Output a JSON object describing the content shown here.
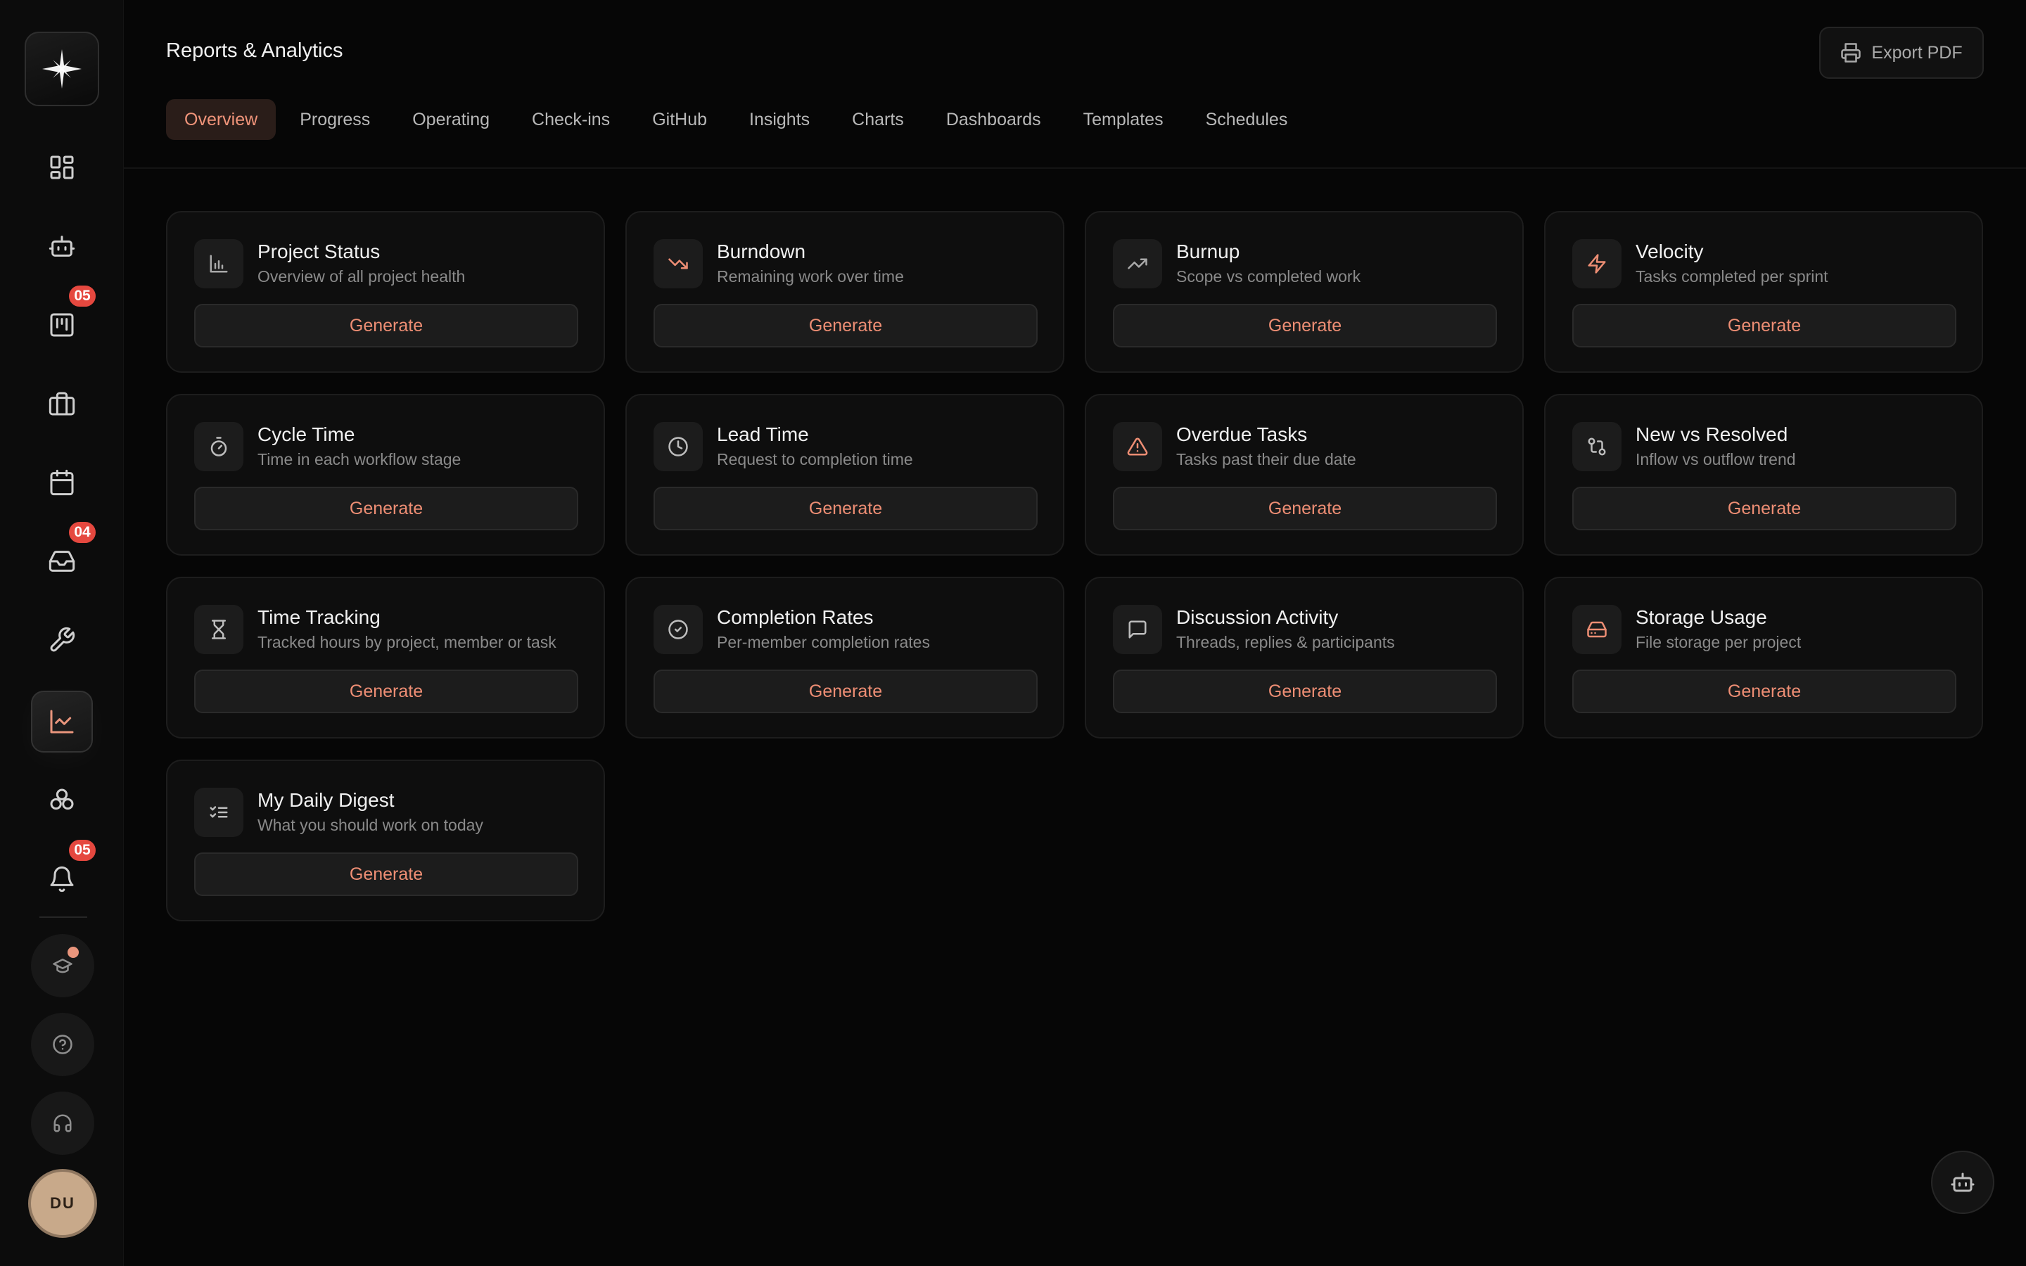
{
  "header": {
    "title": "Reports & Analytics",
    "export_label": "Export PDF"
  },
  "tabs": [
    {
      "label": "Overview",
      "active": true
    },
    {
      "label": "Progress"
    },
    {
      "label": "Operating"
    },
    {
      "label": "Check-ins"
    },
    {
      "label": "GitHub"
    },
    {
      "label": "Insights"
    },
    {
      "label": "Charts"
    },
    {
      "label": "Dashboards"
    },
    {
      "label": "Templates"
    },
    {
      "label": "Schedules"
    }
  ],
  "sidebar": {
    "items": [
      {
        "icon": "dashboard-icon"
      },
      {
        "icon": "robot-icon"
      },
      {
        "icon": "board-icon",
        "badge": "05"
      },
      {
        "icon": "briefcase-icon"
      },
      {
        "icon": "calendar-icon"
      },
      {
        "icon": "inbox-icon",
        "badge": "04"
      },
      {
        "icon": "wrench-icon"
      },
      {
        "icon": "chart-icon",
        "active": true
      },
      {
        "icon": "integrations-icon"
      },
      {
        "icon": "bell-icon",
        "badge": "05"
      }
    ],
    "footer": [
      {
        "icon": "graduation-cap-icon"
      },
      {
        "icon": "help-icon"
      },
      {
        "icon": "headset-icon"
      }
    ],
    "avatar_initials": "DU"
  },
  "reports": [
    {
      "title": "Project Status",
      "subtitle": "Overview of all project health",
      "icon": "bar-chart-icon",
      "button": "Generate"
    },
    {
      "title": "Burndown",
      "subtitle": "Remaining work over time",
      "icon": "trend-down-icon",
      "button": "Generate"
    },
    {
      "title": "Burnup",
      "subtitle": "Scope vs completed work",
      "icon": "trend-up-icon",
      "button": "Generate"
    },
    {
      "title": "Velocity",
      "subtitle": "Tasks completed per sprint",
      "icon": "lightning-icon",
      "button": "Generate"
    },
    {
      "title": "Cycle Time",
      "subtitle": "Time in each workflow stage",
      "icon": "stopwatch-icon",
      "button": "Generate"
    },
    {
      "title": "Lead Time",
      "subtitle": "Request to completion time",
      "icon": "clock-icon",
      "button": "Generate"
    },
    {
      "title": "Overdue Tasks",
      "subtitle": "Tasks past their due date",
      "icon": "warning-icon",
      "button": "Generate"
    },
    {
      "title": "New vs Resolved",
      "subtitle": "Inflow vs outflow trend",
      "icon": "git-compare-icon",
      "button": "Generate"
    },
    {
      "title": "Time Tracking",
      "subtitle": "Tracked hours by project, member or task",
      "icon": "hourglass-icon",
      "button": "Generate"
    },
    {
      "title": "Completion Rates",
      "subtitle": "Per-member completion rates",
      "icon": "check-circle-icon",
      "button": "Generate"
    },
    {
      "title": "Discussion Activity",
      "subtitle": "Threads, replies & participants",
      "icon": "message-icon",
      "button": "Generate"
    },
    {
      "title": "Storage Usage",
      "subtitle": "File storage per project",
      "icon": "hard-drive-icon",
      "button": "Generate"
    },
    {
      "title": "My Daily Digest",
      "subtitle": "What you should work on today",
      "icon": "checklist-icon",
      "button": "Generate"
    }
  ],
  "colors": {
    "accent": "#ee8e74",
    "badge": "#e5483f",
    "background": "#060606"
  }
}
